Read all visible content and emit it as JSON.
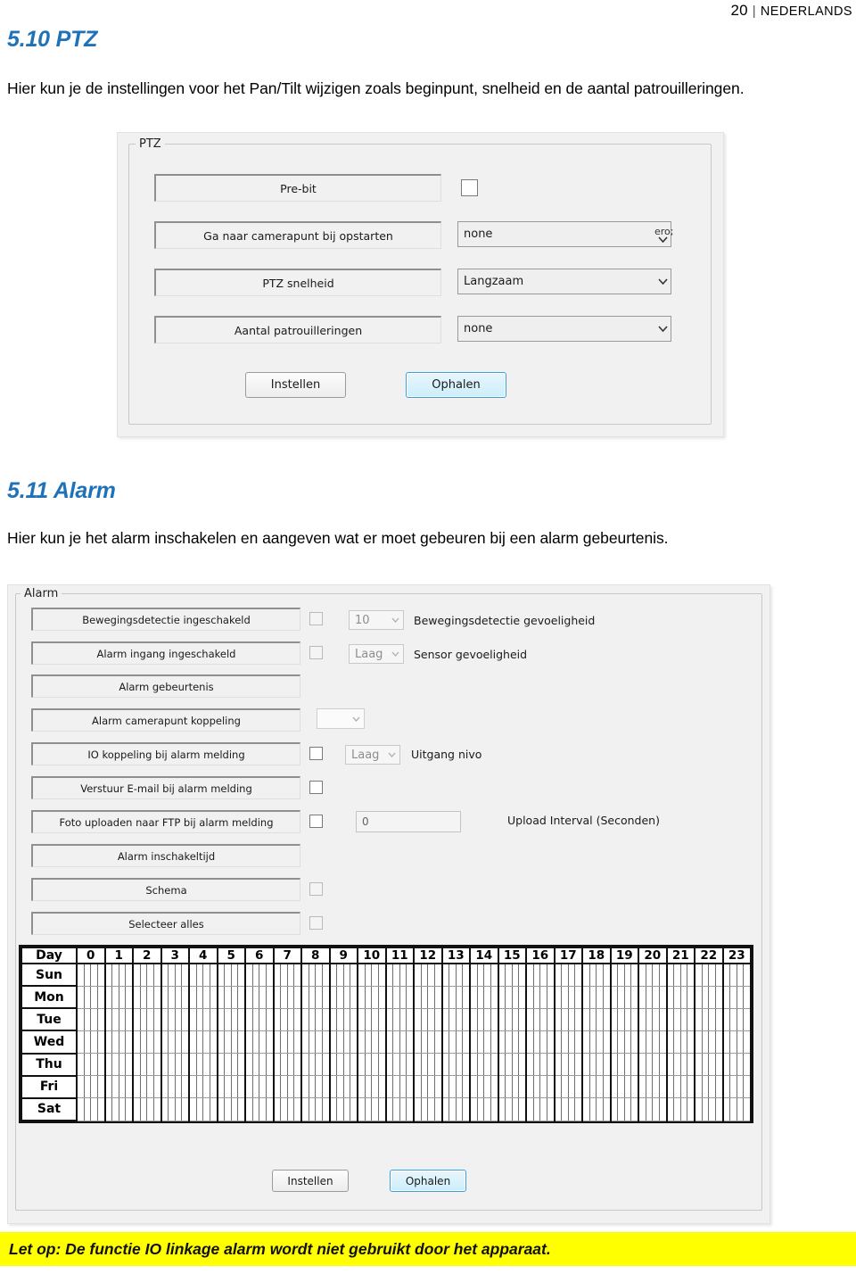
{
  "header": {
    "page_number": "20",
    "separator": "|",
    "language": "NEDERLANDS"
  },
  "sections": [
    {
      "heading": "5.10 PTZ",
      "body": "Hier kun je de instellingen voor het Pan/Tilt wijzigen zoals beginpunt, snelheid en de aantal patrouilleringen."
    },
    {
      "heading": "5.11 Alarm",
      "body": "Hier kun je het alarm inschakelen en aangeven wat er moet gebeuren bij een alarm gebeurtenis."
    }
  ],
  "ptz_dialog": {
    "group_title": "PTZ",
    "rows": [
      {
        "label": "Pre-bit",
        "control": "checkbox",
        "checked": false
      },
      {
        "label": "Ga naar camerapunt bij opstarten",
        "control": "combo",
        "value": "none"
      },
      {
        "label": "PTZ snelheid",
        "control": "combo",
        "value": "Langzaam"
      },
      {
        "label": "Aantal patrouilleringen",
        "control": "combo",
        "value": "none"
      }
    ],
    "buttons": [
      {
        "label": "Instellen",
        "focused": false
      },
      {
        "label": "Ophalen",
        "focused": true
      }
    ]
  },
  "alarm_dialog": {
    "group_title": "Alarm",
    "rows": [
      {
        "label": "Bewegingsdetectie ingeschakeld",
        "checkbox": true,
        "checkbox_dim": true,
        "control": "combo",
        "value": "10",
        "dim": true,
        "caption": "Bewegingsdetectie gevoeligheid"
      },
      {
        "label": "Alarm ingang ingeschakeld",
        "checkbox": true,
        "checkbox_dim": true,
        "control": "combo",
        "value": "Laag",
        "dim": true,
        "caption": "Sensor gevoeligheid"
      },
      {
        "label": "Alarm gebeurtenis",
        "checkbox": false,
        "control": "none",
        "value": "",
        "caption": ""
      },
      {
        "label": "Alarm camerapunt koppeling",
        "checkbox": false,
        "control": "combo-empty",
        "value": "",
        "caption": ""
      },
      {
        "label": "IO koppeling bij alarm melding",
        "checkbox": true,
        "checkbox_dim": false,
        "control": "combo",
        "value": "Laag",
        "dim": true,
        "caption": "Uitgang nivo"
      },
      {
        "label": "Verstuur E-mail bij alarm melding",
        "checkbox": true,
        "checkbox_dim": false,
        "control": "none",
        "value": "",
        "caption": ""
      },
      {
        "label": "Foto uploaden naar FTP bij alarm melding",
        "checkbox": true,
        "checkbox_dim": false,
        "control": "text",
        "value": "0",
        "caption": "Upload Interval (Seconden)"
      },
      {
        "label": "Alarm inschakeltijd",
        "checkbox": false,
        "control": "none",
        "value": "",
        "caption": ""
      },
      {
        "label": "Schema",
        "checkbox": true,
        "checkbox_dim": true,
        "control": "none",
        "value": "",
        "caption": ""
      },
      {
        "label": "Selecteer alles",
        "checkbox": true,
        "checkbox_dim": true,
        "control": "none",
        "value": "",
        "caption": ""
      }
    ],
    "schedule": {
      "day_header": "Day",
      "hours": [
        "0",
        "1",
        "2",
        "3",
        "4",
        "5",
        "6",
        "7",
        "8",
        "9",
        "10",
        "11",
        "12",
        "13",
        "14",
        "15",
        "16",
        "17",
        "18",
        "19",
        "20",
        "21",
        "22",
        "23"
      ],
      "days": [
        "Sun",
        "Mon",
        "Tue",
        "Wed",
        "Thu",
        "Fri",
        "Sat"
      ],
      "subdivisions_per_hour": 4,
      "selected_cells": []
    },
    "buttons": [
      {
        "label": "Instellen",
        "focused": false
      },
      {
        "label": "Ophalen",
        "focused": true
      }
    ]
  },
  "footer_note": "Let op: De functie IO linkage alarm wordt niet gebruikt door het apparaat.",
  "colors": {
    "heading": "#1f72b8",
    "note_background": "#ffff00",
    "dialog_background": "#f1f1f1",
    "focus_border": "#3da2d6"
  }
}
